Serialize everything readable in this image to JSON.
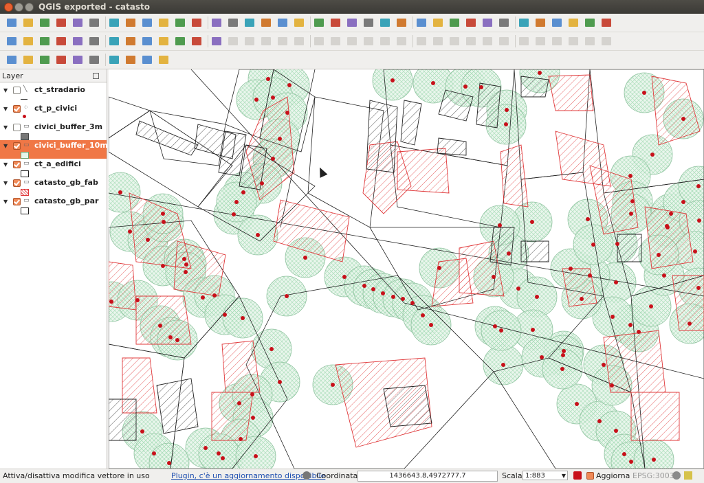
{
  "window": {
    "title": "QGIS exported - catasto"
  },
  "toolbar1": [
    "new-project",
    "open-project",
    "save-project",
    "save-as",
    "print-composer",
    "composer-manager",
    "pan",
    "pan-to-selection",
    "zoom-in",
    "zoom-out",
    "zoom-native",
    "zoom-full",
    "zoom-selection",
    "zoom-layer",
    "zoom-last",
    "zoom-next",
    "refresh",
    "new-shapefile",
    "new-spatialite",
    "add-vector",
    "add-raster",
    "add-postgis",
    "add-spatialite",
    "add-wms",
    "add-wcs",
    "add-wfs",
    "add-delimited",
    "add-oracle",
    "label-tool",
    "label-pin",
    "label-show",
    "label-move",
    "label-rotate",
    "label-change",
    "help-icon",
    "whats-this-icon"
  ],
  "toolbar2": [
    "identify",
    "action",
    "select-features",
    "expression-select",
    "open-attribute-table",
    "field-calculator",
    "measure",
    "annotation",
    "text-annotation",
    "map-tips",
    "toggle-editing",
    "current-edits",
    "save-edits",
    "add-feature",
    "move-feature",
    "node-tool",
    "delete-selected",
    "cut-features",
    "copy-features",
    "paste-features",
    "undo",
    "redo",
    "simplify",
    "add-ring",
    "add-part",
    "fill-ring",
    "delete-ring",
    "delete-part",
    "reshape",
    "offset-curve",
    "split-features",
    "split-parts",
    "merge-features",
    "merge-attributes",
    "rotate-point",
    "rotate-symbols"
  ],
  "toolbar3": [
    "db-manager-1",
    "db-manager-2",
    "db-manager-3",
    "plugin-a",
    "plugin-b",
    "plugin-c",
    "plugin-d",
    "plugin-e",
    "plugin-f",
    "plugin-g"
  ],
  "panel": {
    "title": "Layer"
  },
  "layers": [
    {
      "name": "ct_stradario",
      "checked": false,
      "selected": false,
      "sym": "line"
    },
    {
      "name": "ct_p_civici",
      "checked": true,
      "selected": false,
      "sym": "point"
    },
    {
      "name": "civici_buffer_3m",
      "checked": false,
      "selected": false,
      "sym": "fill-grey"
    },
    {
      "name": "civici_buffer_10m",
      "checked": true,
      "selected": true,
      "sym": "fill-green"
    },
    {
      "name": "ct_a_edifici",
      "checked": true,
      "selected": false,
      "sym": "fill-white"
    },
    {
      "name": "catasto_gb_fab",
      "checked": true,
      "selected": false,
      "sym": "fill-redhatch"
    },
    {
      "name": "catasto_gb_par",
      "checked": true,
      "selected": false,
      "sym": "fill-white"
    }
  ],
  "status": {
    "message": "Attiva/disattiva modifica vettore in uso",
    "plugin_link": "Plugin, c'è un aggiornamento disponibile",
    "coord_label": "Coordinata:",
    "coord_value": "1436643.8,4972777.7",
    "scale_label": "Scala",
    "scale_value": "1:883",
    "render_label": "Aggiorna",
    "crs": "EPSG:3003"
  },
  "colors": {
    "accent": "#f07746",
    "hatch_red": "#e0383a",
    "buffer_green": "#9fd8b0",
    "point_red": "#c8101a"
  }
}
